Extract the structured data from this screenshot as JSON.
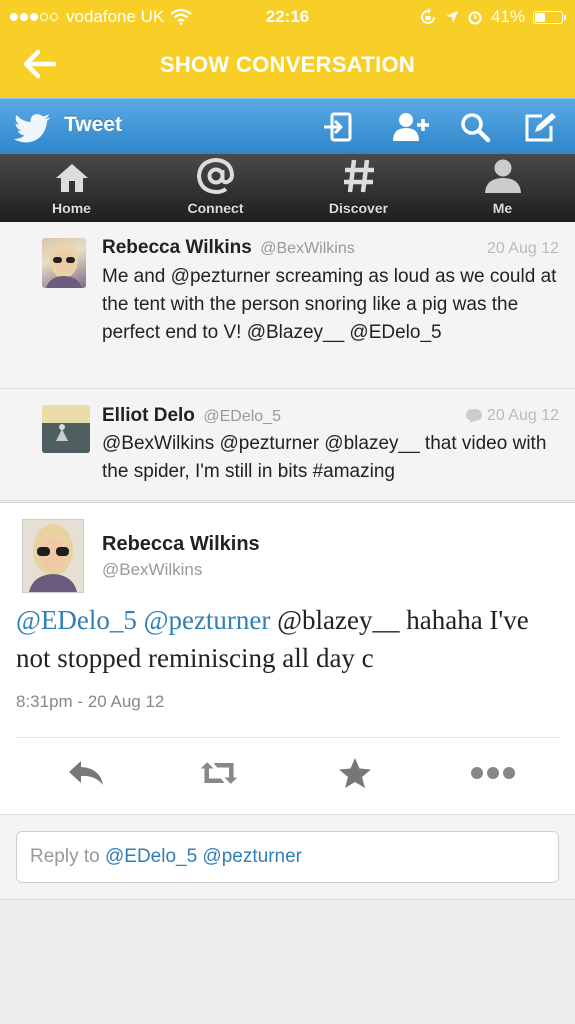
{
  "status_bar": {
    "carrier": "vodafone UK",
    "time": "22:16",
    "battery": "41%",
    "battery_level": 0.41
  },
  "nav": {
    "title": "SHOW CONVERSATION"
  },
  "twitter_bar": {
    "label": "Tweet"
  },
  "tabs": [
    {
      "label": "Home",
      "icon": "home-icon"
    },
    {
      "label": "Connect",
      "icon": "at-icon"
    },
    {
      "label": "Discover",
      "icon": "hashtag-icon"
    },
    {
      "label": "Me",
      "icon": "person-icon"
    }
  ],
  "conversation": [
    {
      "name": "Rebecca Wilkins",
      "handle": "@BexWilkins",
      "date": "20 Aug 12",
      "text": "Me and @pezturner screaming as loud as we could at the tent with the person snoring like a pig was the perfect end to V! @Blazey__ @EDelo_5"
    },
    {
      "name": "Elliot Delo",
      "handle": "@EDelo_5",
      "date": "20 Aug 12",
      "text": "@BexWilkins @pezturner @blazey__ that video with the spider, I'm still in bits #amazing"
    }
  ],
  "main_tweet": {
    "name": "Rebecca Wilkins",
    "handle": "@BexWilkins",
    "mention1": "@EDelo_5",
    "mention2": "@pezturner",
    "text_rest": "@blazey__ hahaha I've not stopped reminiscing all day c",
    "timestamp": "8:31pm - 20 Aug 12"
  },
  "reply": {
    "prefix": "Reply to",
    "mentions": "@EDelo_5 @pezturner"
  },
  "colors": {
    "header_yellow": "#f7cf26",
    "twitter_blue": "#3d95d6",
    "mention_blue": "#2f7fb8"
  }
}
